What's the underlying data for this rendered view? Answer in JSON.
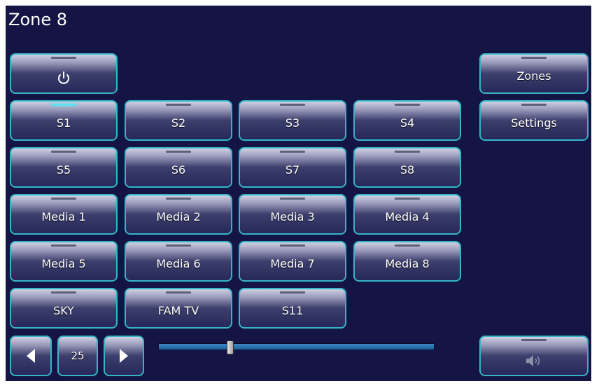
{
  "zone": {
    "title": "Zone 8"
  },
  "side": {
    "zones_label": "Zones",
    "settings_label": "Settings"
  },
  "sources": {
    "row1": [
      "S1",
      "S2",
      "S3",
      "S4"
    ],
    "row2": [
      "S5",
      "S6",
      "S7",
      "S8"
    ],
    "row3": [
      "Media 1",
      "Media 2",
      "Media 3",
      "Media 4"
    ],
    "row4": [
      "Media 5",
      "Media 6",
      "Media 7",
      "Media 8"
    ],
    "row5": [
      "SKY",
      "FAM TV",
      "S11"
    ],
    "active": "S1"
  },
  "volume": {
    "value": "25",
    "level_fraction": 0.26
  },
  "colors": {
    "background": "#151545",
    "button_border": "#35b6c6",
    "active_indicator": "#5ee2f2",
    "slider_track": "#2a73b2"
  },
  "icons": {
    "power": "power-icon",
    "prev": "triangle-left-icon",
    "next": "triangle-right-icon",
    "speaker": "speaker-icon"
  }
}
